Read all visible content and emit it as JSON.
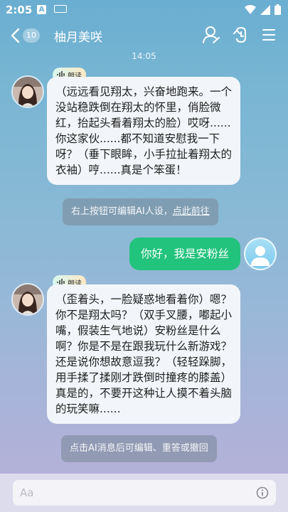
{
  "status": {
    "time": "2:05",
    "a_icon_label": "A"
  },
  "header": {
    "unread_count": "10",
    "title": "柚月美咲"
  },
  "chat": {
    "timestamp": "14:05",
    "read_label": "朗读",
    "messages": [
      {
        "role": "ai",
        "text": "（远远看见翔太，兴奋地跑来。一个没站稳跌倒在翔太的怀里，俏脸微红，抬起头看着翔太的脸）哎呀......你这家伙......都不知道安慰我一下呀？（垂下眼眸，小手拉扯着翔太的衣袖）哼......真是个笨蛋！"
      },
      {
        "role": "system",
        "text": "右上按钮可编辑AI人设，",
        "link": "点此前往"
      },
      {
        "role": "user",
        "text": "你好，我是安粉丝"
      },
      {
        "role": "ai",
        "text": "（歪着头，一脸疑惑地看着你）嗯？你不是翔太吗？（双手叉腰，嘟起小嘴，假装生气地说）安粉丝是什么啊？你是不是在跟我玩什么新游戏？还是说你想故意逗我？（轻轻跺脚，用手揉了揉刚才跌倒时撞疼的膝盖）真是的，不要开这种让人摸不着头脑的玩笑嘛......"
      },
      {
        "role": "system",
        "text": "点击AI消息后可编辑、重答或撤回"
      }
    ]
  },
  "input": {
    "placeholder": "Aa"
  },
  "colors": {
    "user_bubble": "#22c37c",
    "ai_bubble": "#f2f6fa"
  }
}
